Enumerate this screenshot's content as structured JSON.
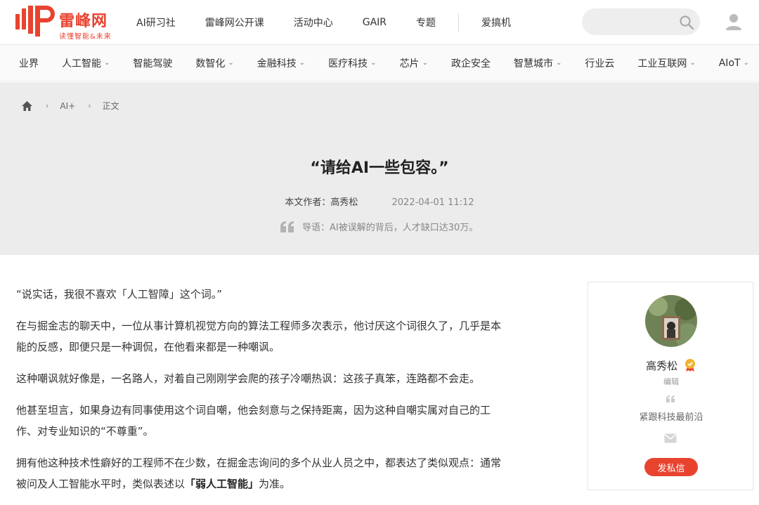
{
  "brand": {
    "name": "雷峰网",
    "slogan": "读懂智能&未来",
    "accent": "#e8432f"
  },
  "topnav": [
    {
      "label": "AI研习社"
    },
    {
      "label": "雷峰网公开课"
    },
    {
      "label": "活动中心"
    },
    {
      "label": "GAIR"
    },
    {
      "label": "专题"
    },
    {
      "label": "爱搞机"
    }
  ],
  "search": {
    "placeholder": "",
    "icon": "search-icon"
  },
  "categories": [
    {
      "label": "业界",
      "caret": ""
    },
    {
      "label": "人工智能",
      "caret": "⌄"
    },
    {
      "label": "智能驾驶",
      "caret": ""
    },
    {
      "label": "数智化",
      "caret": "⌄"
    },
    {
      "label": "金融科技",
      "caret": "⌄"
    },
    {
      "label": "医疗科技",
      "caret": "⌄"
    },
    {
      "label": "芯片",
      "caret": "⌄"
    },
    {
      "label": "政企安全",
      "caret": ""
    },
    {
      "label": "智慧城市",
      "caret": "⌄"
    },
    {
      "label": "行业云",
      "caret": ""
    },
    {
      "label": "工业互联网",
      "caret": "⌄"
    },
    {
      "label": "AIoT",
      "caret": "⌄"
    }
  ],
  "breadcrumb": {
    "sep": "›",
    "items": [
      "AI+",
      "正文"
    ]
  },
  "article": {
    "title": "“请给AI一些包容。”",
    "author_label": "本文作者：",
    "author": "高秀松",
    "date": "2022-04-01 11:12",
    "lead_label": "导语：",
    "lead": "AI被误解的背后，人才缺口达30万。",
    "paragraphs": [
      {
        "text": "“说实话，我很不喜欢「人工智障」这个词。”"
      },
      {
        "text": "在与掘金志的聊天中，一位从事计算机视觉方向的算法工程师多次表示，他讨厌这个词很久了，几乎是本能的反感，即便只是一种调侃，在他看来都是一种嘲讽。"
      },
      {
        "text": "这种嘲讽就好像是，一名路人，对着自己刚刚学会爬的孩子冷嘲热讽：这孩子真笨，连路都不会走。"
      },
      {
        "text": "他甚至坦言，如果身边有同事使用这个词自嘲，他会刻意与之保持距离，因为这种自嘲实属对自己的工作、对专业知识的“不尊重”。"
      },
      {
        "text": "拥有他这种技术性癖好的工程师不在少数，在掘金志询问的多个从业人员之中，都表达了类似观点：通常被问及人工智能水平时，类似表述以",
        "bold": "「弱人工智能」",
        "tail": "为准。"
      }
    ]
  },
  "author_card": {
    "name": "高秀松",
    "role": "编辑",
    "motto": "紧跟科技最前沿",
    "message_button": "发私信"
  }
}
